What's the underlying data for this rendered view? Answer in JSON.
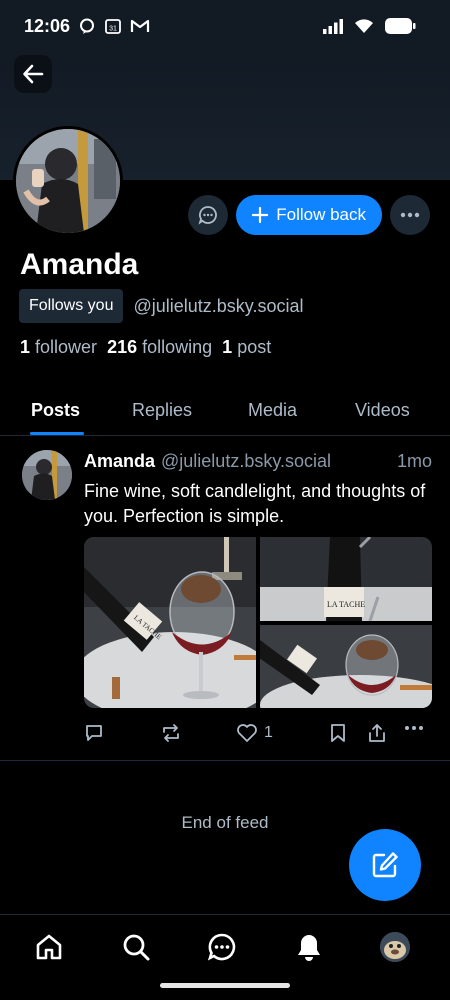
{
  "status_bar": {
    "time": "12:06",
    "calendar_day": "31"
  },
  "profile": {
    "name": "Amanda",
    "follows_you_label": "Follows you",
    "handle": "@julielutz.bsky.social",
    "followers_count": "1",
    "followers_label": "follower",
    "following_count": "216",
    "following_label": "following",
    "posts_count": "1",
    "posts_label": "post",
    "follow_back_label": "Follow back"
  },
  "tabs": [
    {
      "label": "Posts",
      "active": true
    },
    {
      "label": "Replies",
      "active": false
    },
    {
      "label": "Media",
      "active": false
    },
    {
      "label": "Videos",
      "active": false
    }
  ],
  "post": {
    "author": "Amanda",
    "handle": "@julielutz.bsky.social",
    "time": "1mo",
    "text": "Fine wine, soft candlelight, and thoughts of you. Perfection is simple.",
    "like_count": "1",
    "image_1_label": "LA TACHE",
    "image_2_label": "LA TACHE"
  },
  "feed": {
    "end_label": "End of feed"
  },
  "colors": {
    "accent": "#1083fe",
    "background": "#000000",
    "header_bg": "#121a24",
    "muted_text": "#aebbc9",
    "button_bg": "#1e2936"
  },
  "icons": {
    "back": "arrow-left-icon",
    "message": "chat-bubble-icon",
    "more": "ellipsis-icon",
    "reply": "reply-icon",
    "repost": "repost-icon",
    "like": "heart-icon",
    "bookmark": "bookmark-icon",
    "share": "share-icon",
    "compose": "compose-icon",
    "home": "home-icon",
    "search": "search-icon",
    "chat": "chat-icon",
    "notifications": "bell-icon"
  }
}
